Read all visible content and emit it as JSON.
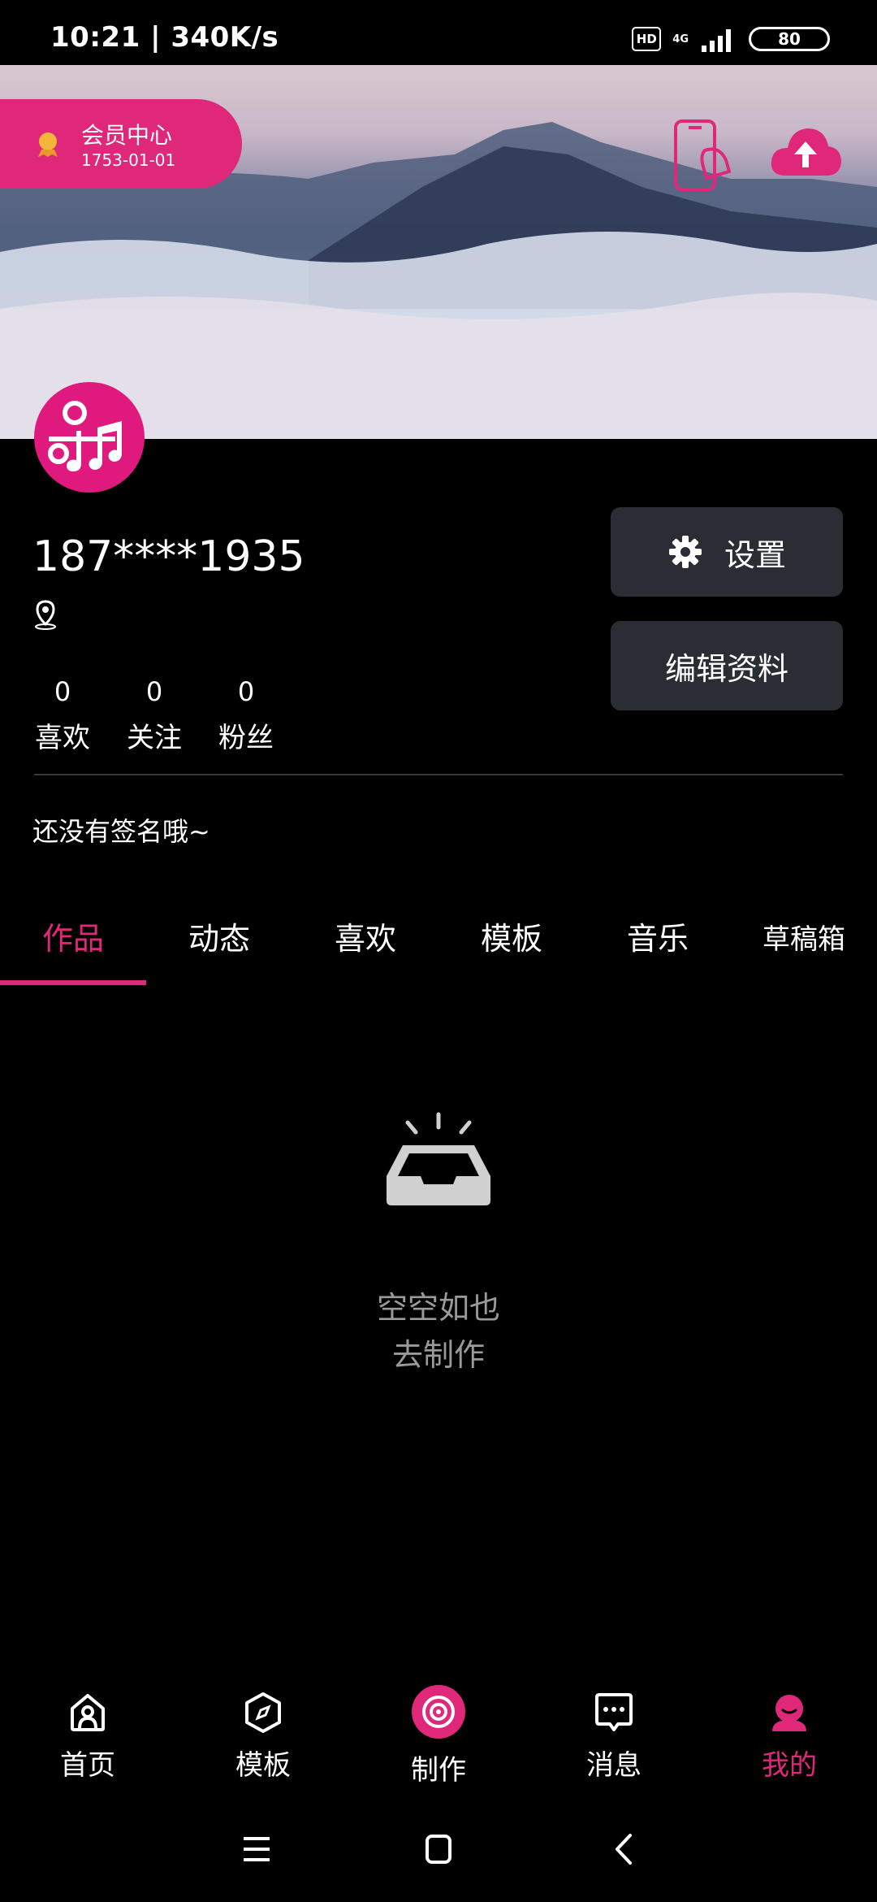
{
  "status_bar": {
    "time": "10:21 | 340K/s",
    "hd": "HD",
    "network": "4G",
    "battery": "80"
  },
  "header": {
    "vip_title": "会员中心",
    "vip_date": "1753-01-01"
  },
  "profile": {
    "username": "187****1935",
    "stats": [
      {
        "num": "0",
        "label": "喜欢"
      },
      {
        "num": "0",
        "label": "关注"
      },
      {
        "num": "0",
        "label": "粉丝"
      }
    ],
    "settings_label": "设置",
    "edit_profile_label": "编辑资料",
    "signature": "还没有签名哦~"
  },
  "tabs": [
    {
      "label": "作品",
      "active": true
    },
    {
      "label": "动态"
    },
    {
      "label": "喜欢"
    },
    {
      "label": "模板"
    },
    {
      "label": "音乐"
    },
    {
      "label": "草稿箱"
    }
  ],
  "empty_state": {
    "line1": "空空如也",
    "line2": "去制作"
  },
  "bottom_nav": [
    {
      "label": "首页",
      "icon": "home-icon"
    },
    {
      "label": "模板",
      "icon": "compass-icon"
    },
    {
      "label": "制作",
      "icon": "create-icon"
    },
    {
      "label": "消息",
      "icon": "message-icon"
    },
    {
      "label": "我的",
      "icon": "profile-icon",
      "active": true
    }
  ],
  "colors": {
    "accent": "#e0287a",
    "button_bg": "#2a2d33",
    "background": "#000000"
  }
}
